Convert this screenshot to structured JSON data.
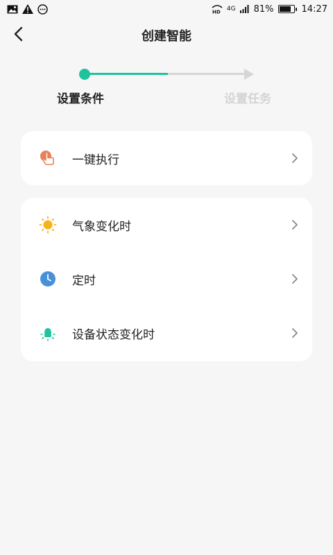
{
  "status_bar": {
    "left_icons": [
      "image-icon",
      "warning-icon",
      "chat-bubble-icon"
    ],
    "network_label": "4G",
    "battery_percent": "81%",
    "battery_level": 0.81,
    "time": "14:27"
  },
  "header": {
    "title": "创建智能",
    "back_icon": "back-arrow-icon"
  },
  "steps": {
    "current": 1,
    "items": [
      {
        "label": "设置条件",
        "state": "active"
      },
      {
        "label": "设置任务",
        "state": "inactive"
      }
    ],
    "active_color": "#1ec39e",
    "inactive_color": "#d6d6d6"
  },
  "conditions": {
    "group1": [
      {
        "label": "一键执行",
        "icon": "tap-hand-icon",
        "color": "#e8805a"
      }
    ],
    "group2": [
      {
        "label": "气象变化时",
        "icon": "sun-icon",
        "color": "#f7b21a"
      },
      {
        "label": "定时",
        "icon": "clock-icon",
        "color": "#4a90d9"
      },
      {
        "label": "设备状态变化时",
        "icon": "device-bulb-icon",
        "color": "#1ec39e"
      }
    ]
  }
}
